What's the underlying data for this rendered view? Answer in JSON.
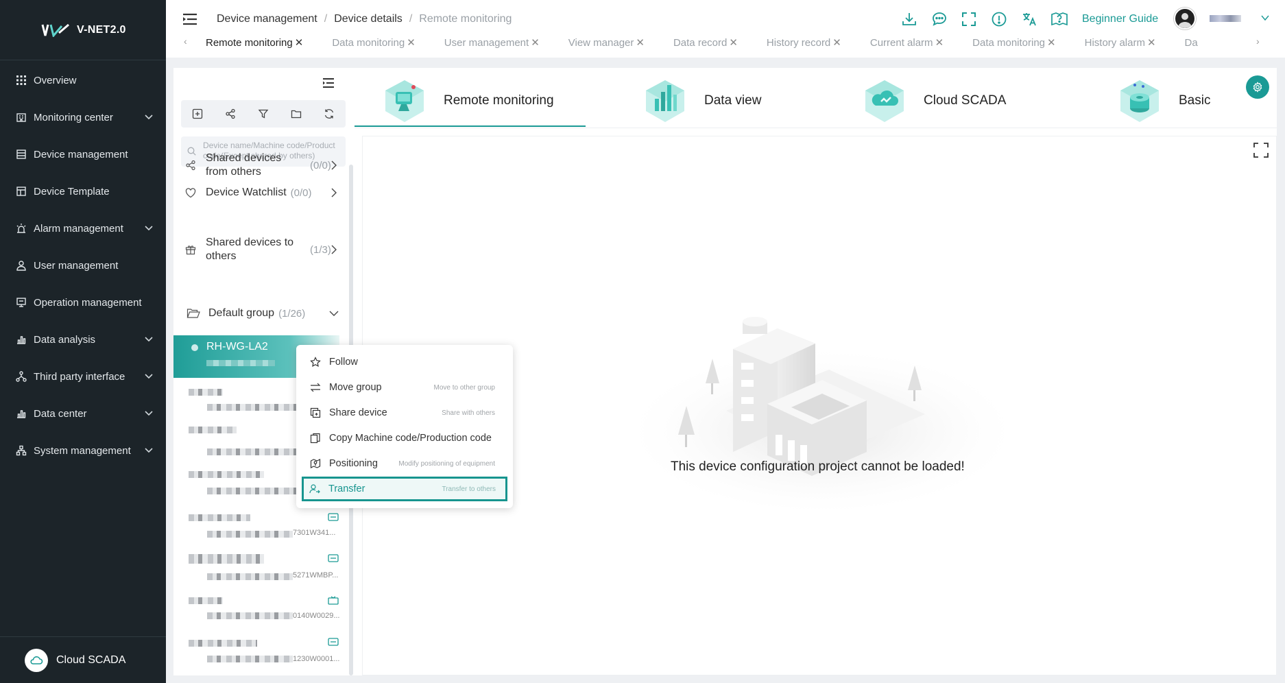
{
  "app": {
    "brand": "V-NET2.0"
  },
  "sidebar": {
    "items": [
      {
        "label": "Overview",
        "icon": "grid-icon",
        "expandable": false
      },
      {
        "label": "Monitoring center",
        "icon": "building-icon",
        "expandable": true
      },
      {
        "label": "Device management",
        "icon": "device-icon",
        "expandable": false
      },
      {
        "label": "Device Template",
        "icon": "template-icon",
        "expandable": false
      },
      {
        "label": "Alarm management",
        "icon": "alarm-icon",
        "expandable": true
      },
      {
        "label": "User management",
        "icon": "user-icon",
        "expandable": false
      },
      {
        "label": "Operation management",
        "icon": "operation-icon",
        "expandable": false
      },
      {
        "label": "Data analysis",
        "icon": "bar-chart-icon",
        "expandable": true
      },
      {
        "label": "Third party interface",
        "icon": "network-icon",
        "expandable": true
      },
      {
        "label": "Data center",
        "icon": "bar-chart-icon",
        "expandable": true
      },
      {
        "label": "System management",
        "icon": "hierarchy-icon",
        "expandable": true
      }
    ],
    "footer": "Cloud SCADA"
  },
  "header": {
    "breadcrumb": [
      "Device management",
      "Device details",
      "Remote monitoring"
    ],
    "guide": "Beginner Guide"
  },
  "tabs": [
    {
      "label": "Remote monitoring",
      "active": true
    },
    {
      "label": "Data monitoring"
    },
    {
      "label": "User management"
    },
    {
      "label": "View manager"
    },
    {
      "label": "Data record"
    },
    {
      "label": "History record"
    },
    {
      "label": "Current alarm"
    },
    {
      "label": "Data monitoring"
    },
    {
      "label": "History alarm"
    },
    {
      "label": "Da"
    }
  ],
  "leftpanel": {
    "search_placeholder": "Device name/Machine code/Product code(Except shared by others)",
    "shared_from": {
      "label": "Shared devices from others",
      "count": "(0/0)"
    },
    "watchlist": {
      "label": "Device Watchlist",
      "count": "(0/0)"
    },
    "shared_to": {
      "label": "Shared devices to others",
      "count": "(1/3)"
    },
    "group": {
      "label": "Default group",
      "count": "(1/26)"
    },
    "selected_device": "RH-WG-LA2",
    "device_codes": [
      "7301W341...",
      "5271WMBP...",
      "0140W0029...",
      "1230W0001..."
    ]
  },
  "main": {
    "tabs": [
      "Remote monitoring",
      "Data view",
      "Cloud SCADA",
      "Basic"
    ],
    "empty_message": "This device configuration project cannot be loaded!"
  },
  "context_menu": {
    "items": [
      {
        "label": "Follow",
        "hint": ""
      },
      {
        "label": "Move group",
        "hint": "Move to other group"
      },
      {
        "label": "Share device",
        "hint": "Share with others"
      },
      {
        "label": "Copy Machine code/Production code",
        "hint": ""
      },
      {
        "label": "Positioning",
        "hint": "Modify positioning of equipment"
      },
      {
        "label": "Transfer",
        "hint": "Transfer to others"
      }
    ]
  },
  "colors": {
    "accent": "#1a9a95",
    "sidebar": "#1c2429"
  }
}
